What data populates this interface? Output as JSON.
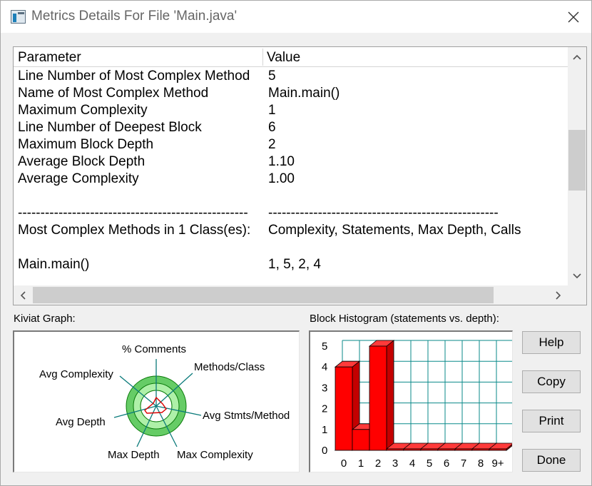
{
  "window": {
    "title": "Metrics Details For File 'Main.java'"
  },
  "list": {
    "columns": [
      "Parameter",
      "Value"
    ],
    "rows": [
      [
        "Line Number of Most Complex Method",
        "5"
      ],
      [
        "Name of Most Complex Method",
        "Main.main()"
      ],
      [
        "Maximum Complexity",
        "1"
      ],
      [
        "Line Number of Deepest Block",
        "6"
      ],
      [
        "Maximum Block Depth",
        "2"
      ],
      [
        "Average Block Depth",
        "1.10"
      ],
      [
        "Average Complexity",
        "1.00"
      ],
      [
        "",
        ""
      ],
      [
        "---------------------------------------------------",
        "---------------------------------------------------"
      ],
      [
        "Most Complex Methods in 1 Class(es):",
        "Complexity, Statements, Max Depth, Calls"
      ],
      [
        "",
        ""
      ],
      [
        "Main.main()",
        "1, 5, 2, 4"
      ]
    ]
  },
  "kiviat": {
    "label": "Kiviat Graph:",
    "axes": [
      "% Comments",
      "Methods/Class",
      "Avg Stmts/Method",
      "Max Complexity",
      "Max Depth",
      "Avg Depth",
      "Avg Complexity"
    ]
  },
  "histogram": {
    "label": "Block Histogram (statements vs. depth):",
    "chart_data": {
      "type": "bar",
      "categories": [
        "0",
        "1",
        "2",
        "3",
        "4",
        "5",
        "6",
        "7",
        "8",
        "9+"
      ],
      "values": [
        4,
        1,
        5,
        0,
        0,
        0,
        0,
        0,
        0,
        0
      ],
      "y_ticks": [
        "0",
        "1",
        "2",
        "3",
        "4",
        "5"
      ],
      "ylim": [
        0,
        5
      ],
      "grid": true,
      "bar_color": "#ff0000"
    }
  },
  "buttons": {
    "help": "Help",
    "copy": "Copy",
    "print": "Print",
    "done": "Done"
  }
}
